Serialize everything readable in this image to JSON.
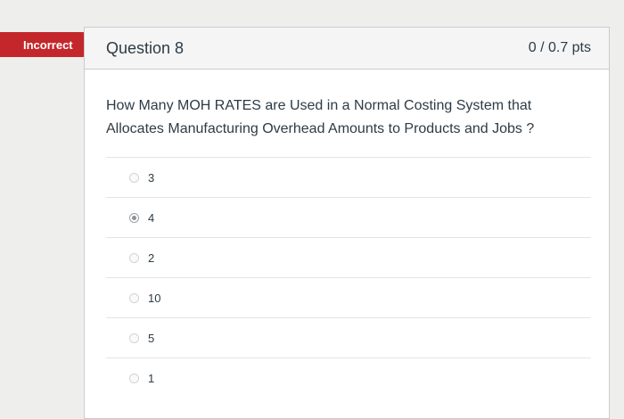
{
  "status": {
    "label": "Incorrect",
    "color": "#c4272b"
  },
  "question": {
    "title": "Question 8",
    "points": "0 / 0.7 pts",
    "text": "How Many MOH RATES are Used in a Normal Costing System that Allocates Manufacturing Overhead Amounts to Products and Jobs ?",
    "answers": [
      {
        "label": "3",
        "selected": false
      },
      {
        "label": "4",
        "selected": true
      },
      {
        "label": "2",
        "selected": false
      },
      {
        "label": "10",
        "selected": false
      },
      {
        "label": "5",
        "selected": false
      },
      {
        "label": "1",
        "selected": false
      }
    ]
  }
}
